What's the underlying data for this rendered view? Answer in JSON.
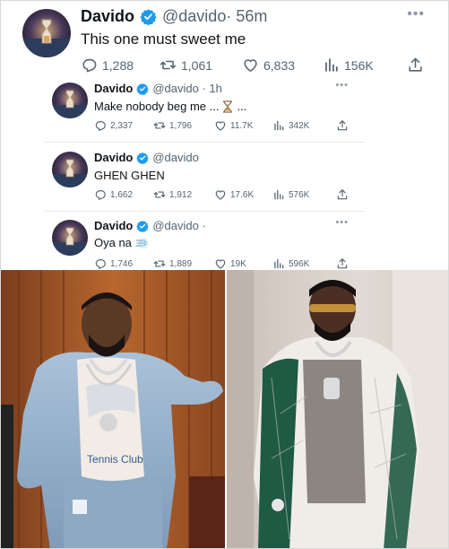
{
  "main_tweet": {
    "name": "Davido",
    "handle": "@davido",
    "time": "· 56m",
    "more": "•••",
    "text": "This one must sweet me",
    "stats": {
      "replies": "1,288",
      "retweets": "1,061",
      "likes": "6,833",
      "views": "156K"
    }
  },
  "replies": [
    {
      "name": "Davido",
      "handle": "@davido · 1h",
      "more": "•••",
      "text": "Make nobody beg me ...",
      "text_suffix": "...",
      "emoji": "hourglass-icon",
      "stats": {
        "replies": "2,337",
        "retweets": "1,796",
        "likes": "11.7K",
        "views": "342K"
      }
    },
    {
      "name": "Davido",
      "handle": "@davido",
      "more": "",
      "text": "GHEN GHEN",
      "stats": {
        "replies": "1,662",
        "retweets": "1,912",
        "likes": "17.6K",
        "views": "576K"
      }
    },
    {
      "name": "Davido",
      "handle": "@davido ·",
      "more": "•••",
      "text": "Oya na",
      "emoji": "dash-icon",
      "stats": {
        "replies": "1,746",
        "retweets": "1,889",
        "likes": "19K",
        "views": "596K"
      }
    }
  ],
  "photos": [
    {
      "shirt_text": "Tennis Club"
    }
  ],
  "colors": {
    "verified": "#1d9bf0",
    "muted": "#536471",
    "text": "#0f1419"
  }
}
